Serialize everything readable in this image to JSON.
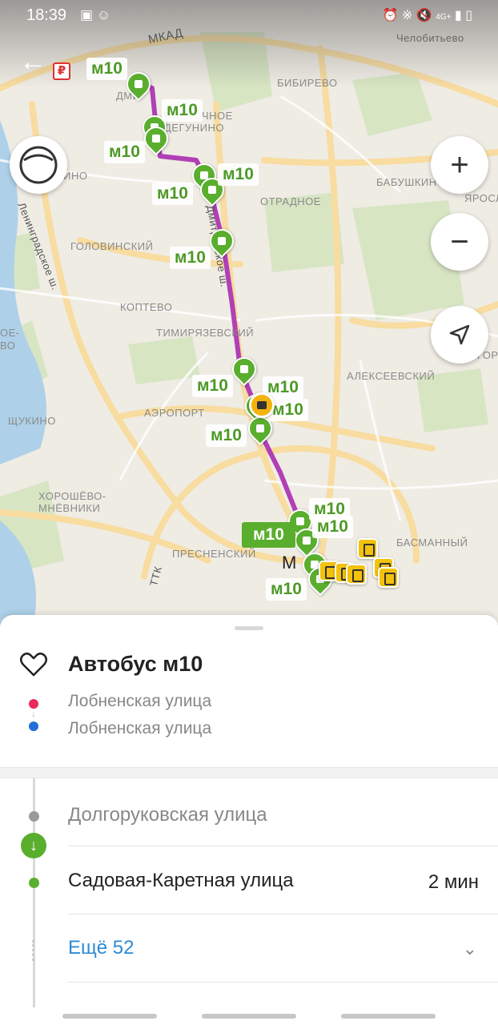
{
  "status_bar": {
    "time": "18:39",
    "left_icons": [
      "image-icon",
      "person-icon"
    ],
    "right_icons": [
      "alarm-icon",
      "bluetooth-icon",
      "mute-icon",
      "signal-icon",
      "battery-icon"
    ],
    "network": "4G+"
  },
  "map": {
    "district_labels": [
      "Челобитьево",
      "БИБИРЕВО",
      "ДМИ",
      "ВОСТОЧНОЕ ДЕГУНИНО",
      "ОТРАДНОЕ",
      "БАБУШКИНСКИЙ",
      "ЯРОСЛАВ",
      "ГОЛОВИНСКИЙ",
      "КОПТЕВО",
      "ТИМИРЯЗЕВСКИЙ",
      "АЛЕКСЕЕВСКИЙ",
      "АЭРОПОРТ",
      "ЩУКИНО",
      "ХОРОШЁВО-МНЁВНИКИ",
      "ПРЕСНЕНСКИЙ",
      "БАСМАННЫЙ",
      "РИНО",
      "ОЕ-",
      "ВО",
      "ГОРОД"
    ],
    "road_labels": [
      "МКАД",
      "Ленинградское ш.",
      "ТТК",
      "Дмитровское ш."
    ],
    "city_center_letter": "М",
    "route_label": "м10",
    "route_color": "#b13fb6",
    "stop_color": "#5aae2e",
    "controls": {
      "zoom_in": "+",
      "zoom_out": "−"
    }
  },
  "sheet": {
    "title": "Автобус м10",
    "from": "Лобненская улица",
    "to": "Лобненская улица",
    "stops": [
      {
        "name": "Долгоруковская улица",
        "passed": true
      },
      {
        "name": "Садовая-Каретная улица",
        "passed": false,
        "eta": "2 мин"
      }
    ],
    "more": "Ещё 52",
    "accent_link": "#2c8bd6",
    "from_color": "#ea2a5a",
    "to_color": "#1f6fd6"
  }
}
